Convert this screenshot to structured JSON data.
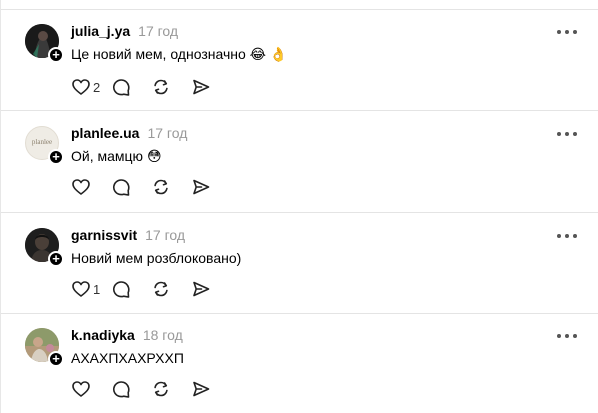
{
  "posts": [
    {
      "username": "julia_j.ya",
      "time": "17 год",
      "text": "Це новий мем, однозначно",
      "emoji": "😂 👌",
      "like_count": "2",
      "avatar_color": "#1c1c1c"
    },
    {
      "username": "planlee.ua",
      "time": "17 год",
      "text": "Ой, мамцю",
      "emoji": "😳",
      "like_count": "",
      "avatar_color": "#efece5"
    },
    {
      "username": "garnissvit",
      "time": "17 год",
      "text": "Новий мем розблоковано)",
      "emoji": "",
      "like_count": "1",
      "avatar_color": "#2a2a2a"
    },
    {
      "username": "k.nadiyka",
      "time": "18 год",
      "text": "АХАХПХАХРХХП",
      "emoji": "",
      "like_count": "",
      "avatar_color": "#9b8a6f"
    }
  ],
  "avatar_logo_text": "planlee",
  "icons": [
    "heart-icon",
    "comment-icon",
    "repost-icon",
    "share-icon",
    "more-icon",
    "follow-plus-icon"
  ]
}
